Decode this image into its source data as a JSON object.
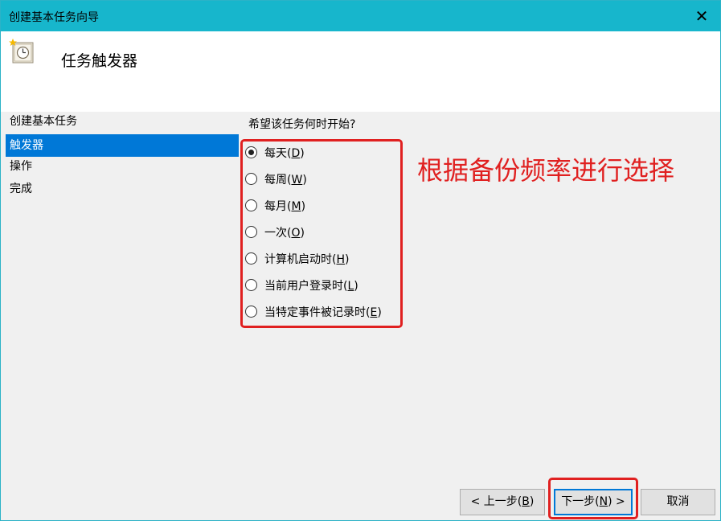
{
  "window": {
    "title": "创建基本任务向导",
    "close_glyph": "✕"
  },
  "header": {
    "heading": "任务触发器",
    "icon": "task-scheduler-clock-icon"
  },
  "steps": [
    {
      "label": "创建基本任务",
      "active": false
    },
    {
      "label": "触发器",
      "active": true
    },
    {
      "label": "操作",
      "active": false
    },
    {
      "label": "完成",
      "active": false
    }
  ],
  "question": "希望该任务何时开始?",
  "options": [
    {
      "label": "每天(D)",
      "text": "每天(",
      "key": "D",
      "checked": true
    },
    {
      "label": "每周(W)",
      "text": "每周(",
      "key": "W",
      "checked": false
    },
    {
      "label": "每月(M)",
      "text": "每月(",
      "key": "M",
      "checked": false
    },
    {
      "label": "一次(O)",
      "text": "一次(",
      "key": "O",
      "checked": false
    },
    {
      "label": "计算机启动时(H)",
      "text": "计算机启动时(",
      "key": "H",
      "checked": false
    },
    {
      "label": "当前用户登录时(L)",
      "text": "当前用户登录时(",
      "key": "L",
      "checked": false
    },
    {
      "label": "当特定事件被记录时(E)",
      "text": "当特定事件被记录时(",
      "key": "E",
      "checked": false
    }
  ],
  "annotation": "根据备份频率进行选择",
  "buttons": {
    "back": {
      "pre": "< 上一步(",
      "key": "B",
      "post": ")"
    },
    "next": {
      "pre": "下一步(",
      "key": "N",
      "post": ") >"
    },
    "cancel": {
      "label": "取消"
    }
  },
  "colors": {
    "titlebar": "#17b6cc",
    "selection": "#0078d7",
    "annotation_red": "#e02020"
  }
}
